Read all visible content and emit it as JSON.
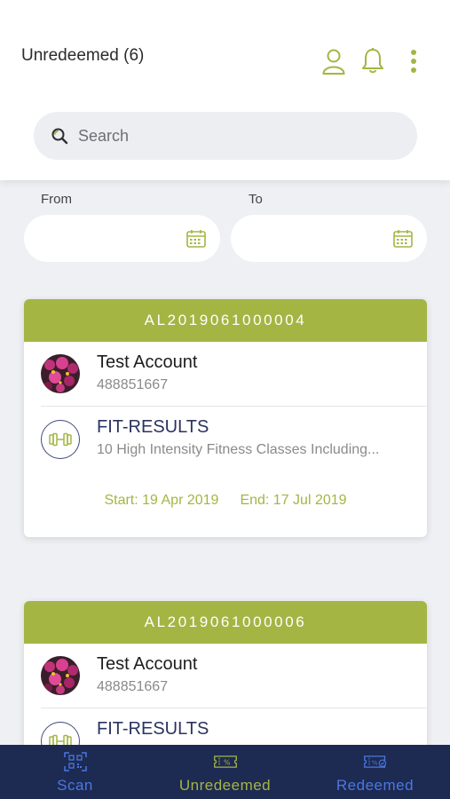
{
  "header": {
    "title": "Unredeemed (6)"
  },
  "search": {
    "placeholder": "Search",
    "value": ""
  },
  "filters": {
    "from_label": "From",
    "to_label": "To",
    "from_value": "",
    "to_value": ""
  },
  "vouchers": [
    {
      "code": "AL2019061000004",
      "account_name": "Test Account",
      "account_number": "488851667",
      "service_name": "FIT-RESULTS",
      "service_desc": "10 High Intensity Fitness Classes Including...",
      "start_text": "Start: 19 Apr 2019",
      "end_text": "End:  17 Jul 2019"
    },
    {
      "code": "AL2019061000006",
      "account_name": "Test Account",
      "account_number": "488851667",
      "service_name": "FIT-RESULTS"
    }
  ],
  "nav": {
    "scan": "Scan",
    "unredeemed": "Unredeemed",
    "redeemed": "Redeemed"
  },
  "colors": {
    "accent_green": "#a4b544",
    "nav_background": "#1d2a52",
    "nav_active": "#a4b544",
    "nav_inactive": "#4a78e0",
    "service_text": "#2a3360"
  },
  "icons": {
    "header": [
      "profile-icon",
      "bell-icon",
      "more-vertical-icon"
    ],
    "search": "search-icon",
    "date": "calendar-icon",
    "service": "dumbbell-icon",
    "nav": [
      "qr-scan-icon",
      "ticket-percent-icon",
      "ticket-check-icon"
    ]
  }
}
